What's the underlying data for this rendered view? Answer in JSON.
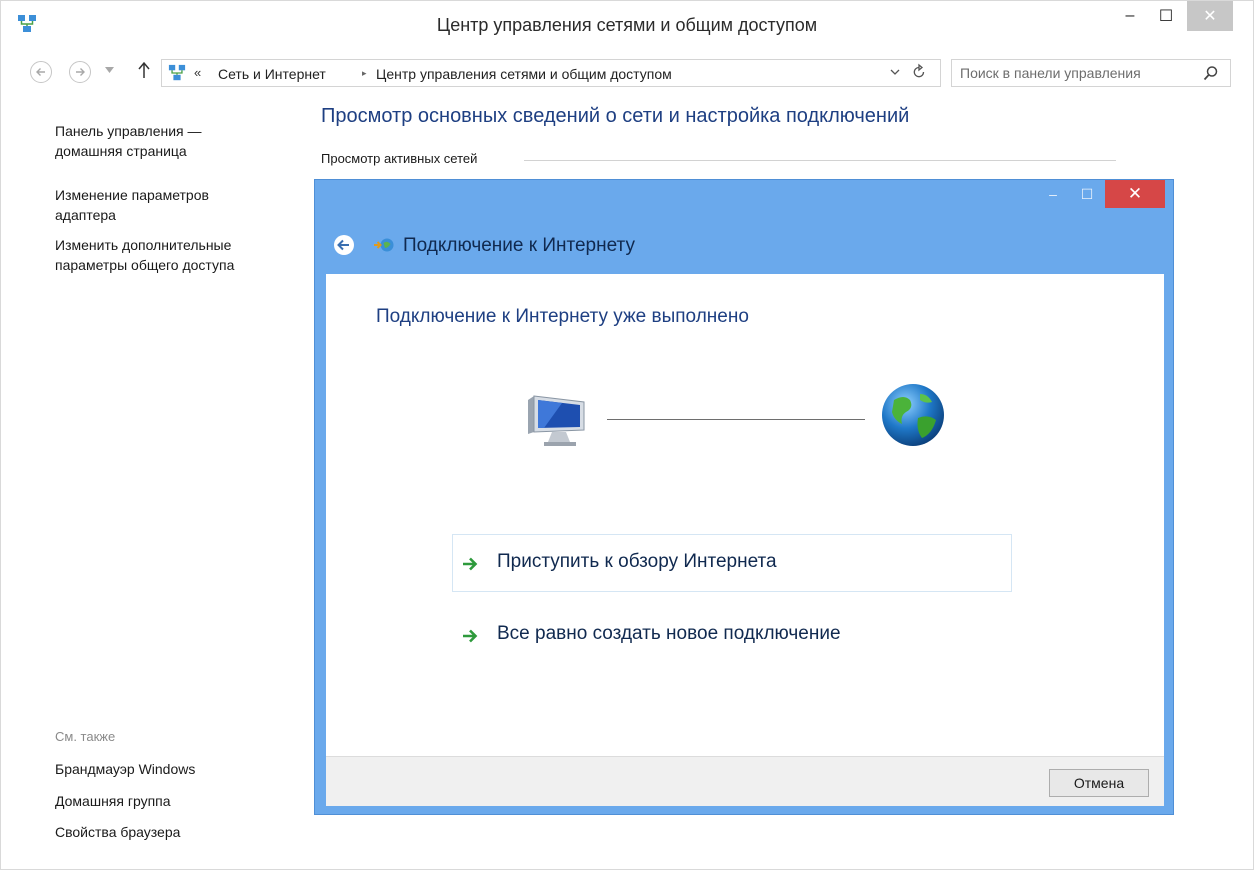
{
  "window": {
    "title": "Центр управления сетями и общим доступом",
    "minimize_glyph": "–",
    "maximize_glyph": "☐",
    "close_glyph": "✕"
  },
  "navbar": {
    "overflow_glyph": "«",
    "crumbs": [
      "Сеть и Интернет",
      "Центр управления сетями и общим доступом"
    ],
    "separator_glyph": "▸",
    "search_placeholder": "Поиск в панели управления"
  },
  "left_pane": {
    "links": [
      "Панель управления —\nдомашняя страница",
      "Изменение параметров\nадаптера",
      "Изменить дополнительные\nпараметры общего доступа"
    ],
    "see_also_title": "См. также",
    "see_also_links": [
      "Брандмауэр Windows",
      "Домашняя группа",
      "Свойства браузера"
    ]
  },
  "main": {
    "heading": "Просмотр основных сведений о сети и настройка подключений",
    "active_networks_label": "Просмотр активных сетей"
  },
  "dialog": {
    "title": "Подключение к Интернету",
    "heading": "Подключение к Интернету уже выполнено",
    "options": [
      "Приступить к обзору Интернета",
      "Все равно создать новое подключение"
    ],
    "cancel_label": "Отмена",
    "minimize_glyph": "–",
    "maximize_glyph": "☐",
    "close_glyph": "✕"
  },
  "icons": {
    "app": "network-icon",
    "back": "back-arrow-icon",
    "forward": "forward-arrow-icon",
    "up": "up-arrow-icon",
    "refresh": "refresh-icon",
    "search": "search-icon",
    "computer": "computer-icon",
    "globe": "globe-icon",
    "option_arrow": "green-arrow-icon"
  },
  "colors": {
    "dialog_frame": "#6aa9ec",
    "dialog_close": "#d64747",
    "heading_blue": "#1e3f82",
    "option_arrow": "#2e9a3c"
  }
}
